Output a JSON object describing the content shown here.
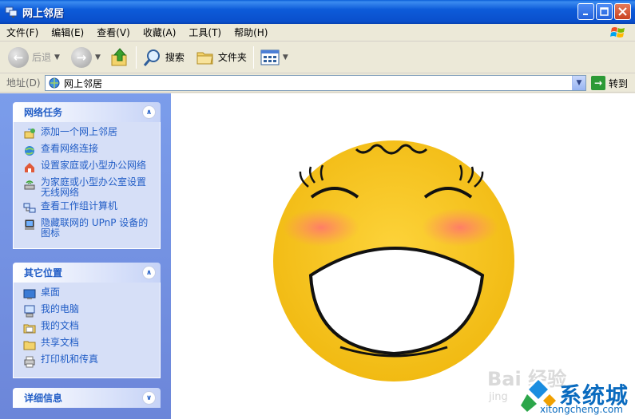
{
  "window": {
    "title": "网上邻居",
    "controls": [
      "minimize",
      "maximize",
      "close"
    ]
  },
  "menu": [
    "文件(F)",
    "编辑(E)",
    "查看(V)",
    "收藏(A)",
    "工具(T)",
    "帮助(H)"
  ],
  "toolbar": {
    "back_label": "后退",
    "search_label": "搜索",
    "folders_label": "文件夹"
  },
  "address": {
    "label": "地址(D)",
    "value": "网上邻居",
    "go_label": "转到"
  },
  "panels": {
    "network_tasks": {
      "title": "网络任务",
      "items": [
        {
          "label": "添加一个网上邻居",
          "icon": "add-network-place-icon"
        },
        {
          "label": "查看网络连接",
          "icon": "network-connections-icon"
        },
        {
          "label": "设置家庭或小型办公网络",
          "icon": "home-network-icon"
        },
        {
          "label": "为家庭或小型办公室设置无线网络",
          "icon": "wireless-network-icon"
        },
        {
          "label": "查看工作组计算机",
          "icon": "workgroup-icon"
        },
        {
          "label": "隐藏联网的 UPnP 设备的图标",
          "icon": "upnp-device-icon"
        }
      ]
    },
    "other_places": {
      "title": "其它位置",
      "items": [
        {
          "label": "桌面",
          "icon": "desktop-icon"
        },
        {
          "label": "我的电脑",
          "icon": "my-computer-icon"
        },
        {
          "label": "我的文档",
          "icon": "my-documents-icon"
        },
        {
          "label": "共享文档",
          "icon": "shared-documents-icon"
        },
        {
          "label": "打印机和传真",
          "icon": "printer-fax-icon"
        }
      ]
    },
    "details": {
      "title": "详细信息"
    }
  },
  "watermarks": {
    "baidu": "Bai 经验",
    "baidu_sub": "jing",
    "brand_name": "系统城",
    "brand_url": "xitongcheng.com"
  },
  "colors": {
    "titlebar": "#0a4fcc",
    "link": "#215dc6",
    "pane": "#7b9deb",
    "smiley": "#f5c11f"
  }
}
